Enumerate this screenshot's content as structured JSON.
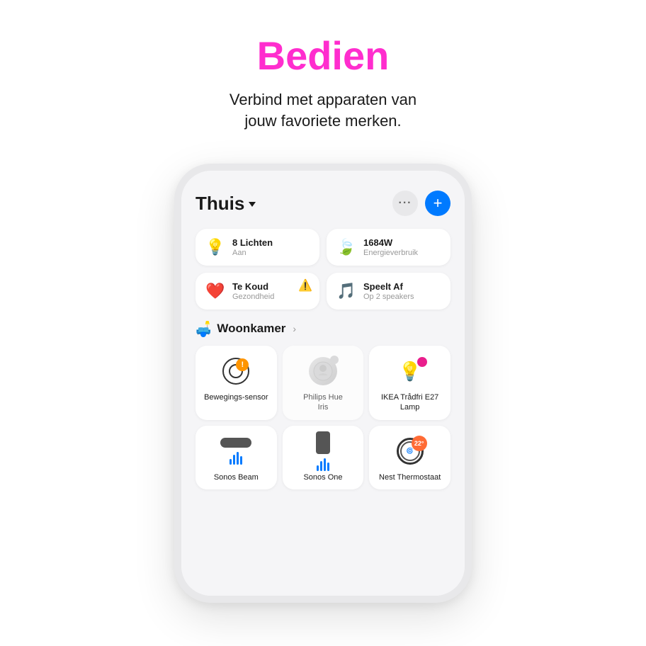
{
  "page": {
    "main_title": "Bedien",
    "subtitle_line1": "Verbind met apparaten van",
    "subtitle_line2": "jouw favoriete merken.",
    "accent_color": "#ff2dce"
  },
  "app": {
    "home_label": "Thuis",
    "more_label": "...",
    "add_label": "+",
    "stats": [
      {
        "icon": "💡",
        "icon_type": "light",
        "title": "8 Lichten",
        "subtitle": "Aan"
      },
      {
        "icon": "🍃",
        "icon_type": "energy",
        "title": "1684W",
        "subtitle": "Energieverbruik"
      },
      {
        "icon": "❤️",
        "icon_type": "health",
        "title": "Te Koud",
        "subtitle": "Gezondheid",
        "has_warning": true
      },
      {
        "icon": "🎵",
        "icon_type": "music",
        "title": "Speelt Af",
        "subtitle": "Op 2 speakers"
      }
    ],
    "room": {
      "name": "Woonkamer",
      "icon": "🛋️"
    },
    "devices": [
      {
        "name": "Bewegings-sensor",
        "type": "motion-sensor",
        "has_warning": true,
        "inactive": false
      },
      {
        "name": "Philips Hue Iris",
        "type": "hue-iris",
        "has_warning": false,
        "inactive": true
      },
      {
        "name": "IKEA Trådfri E27 Lamp",
        "type": "lamp",
        "has_color": true,
        "inactive": false
      },
      {
        "name": "Sonos Beam",
        "type": "sonos-beam",
        "has_warning": false,
        "inactive": false
      },
      {
        "name": "Sonos One",
        "type": "sonos-one",
        "has_warning": false,
        "inactive": false
      },
      {
        "name": "Nest Thermostaat",
        "type": "nest",
        "badge_number": "22°",
        "inactive": false
      }
    ]
  }
}
